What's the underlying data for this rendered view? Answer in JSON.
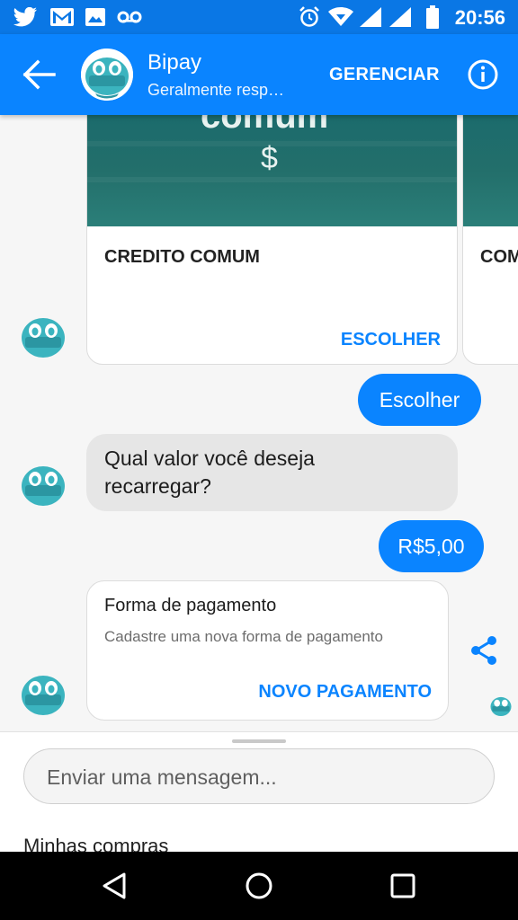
{
  "status_bar": {
    "time": "20:56",
    "left_icons": [
      "twitter-icon",
      "gmail-icon",
      "image-icon",
      "voicemail-icon"
    ],
    "right_icons": [
      "alarm-icon",
      "wifi-icon",
      "signal-icon",
      "signal-icon",
      "battery-icon"
    ]
  },
  "header": {
    "title": "Bipay",
    "subtitle": "Geralmente resp…",
    "manage_label": "GERENCIAR"
  },
  "carousel": {
    "card_title": "CREDITO COMUM",
    "card_action": "ESCOLHER",
    "image_text": "comum",
    "image_symbol": "$",
    "next_card_title": "COM"
  },
  "messages": {
    "user_choose": "Escolher",
    "bot_question_line1": "Qual valor você deseja",
    "bot_question_line2": "recarregar?",
    "user_amount": "R$5,00"
  },
  "payment_card": {
    "title": "Forma de pagamento",
    "subtitle": "Cadastre uma nova forma de pagamento",
    "action": "NOVO PAGAMENTO"
  },
  "composer": {
    "placeholder": "Enviar uma mensagem...",
    "persistent_menu_item": "Minhas compras"
  },
  "colors": {
    "accent": "#0a84ff",
    "status_bar": "#0a77e5",
    "bot_avatar": "#3bb4bf"
  }
}
